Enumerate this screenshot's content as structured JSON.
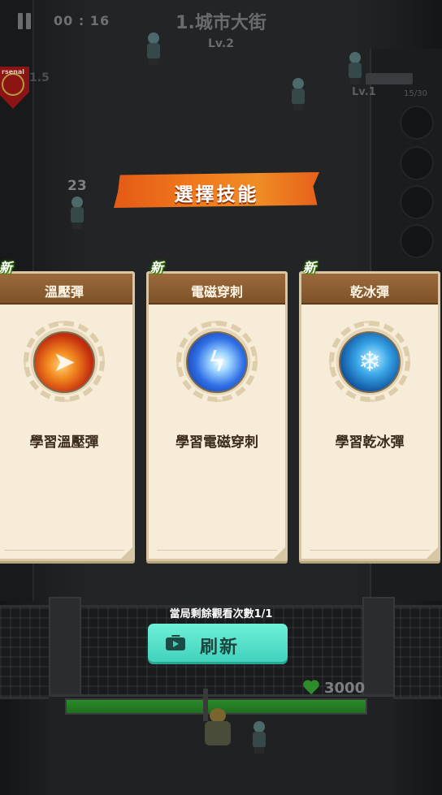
{
  "hud": {
    "timer": "00 : 16",
    "stage_title": "1.城市大街",
    "stage_level": "Lv.2",
    "club_badge_text": "rsenal",
    "club_badge_suffix": "1.5",
    "weapon_level": "Lv.1",
    "ammo": "15/30",
    "damage_number": "23"
  },
  "skill_select": {
    "title": "選擇技能",
    "new_label": "新",
    "cards": [
      {
        "name": "溫壓彈",
        "description": "學習溫壓彈",
        "icon": "fire-bullet-icon",
        "is_new": true
      },
      {
        "name": "電磁穿刺",
        "description": "學習電磁穿刺",
        "icon": "lightning-pierce-icon",
        "is_new": true
      },
      {
        "name": "乾冰彈",
        "description": "學習乾冰彈",
        "icon": "ice-bullet-icon",
        "is_new": true
      }
    ]
  },
  "refresh": {
    "remaining_text": "當局剩餘觀看次數1/1",
    "button_label": "刷新",
    "button_icon": "tv-play-icon"
  },
  "base": {
    "hp_value": "3000",
    "hp_fraction": 1.0
  },
  "colors": {
    "banner": "#f07a1c",
    "card_bg": "#f6ecd7",
    "card_header": "#8b5e33",
    "refresh_button": "#4fdcc6",
    "new_badge_glow": "#3b9a00",
    "hp_green": "#2b8b2a"
  }
}
